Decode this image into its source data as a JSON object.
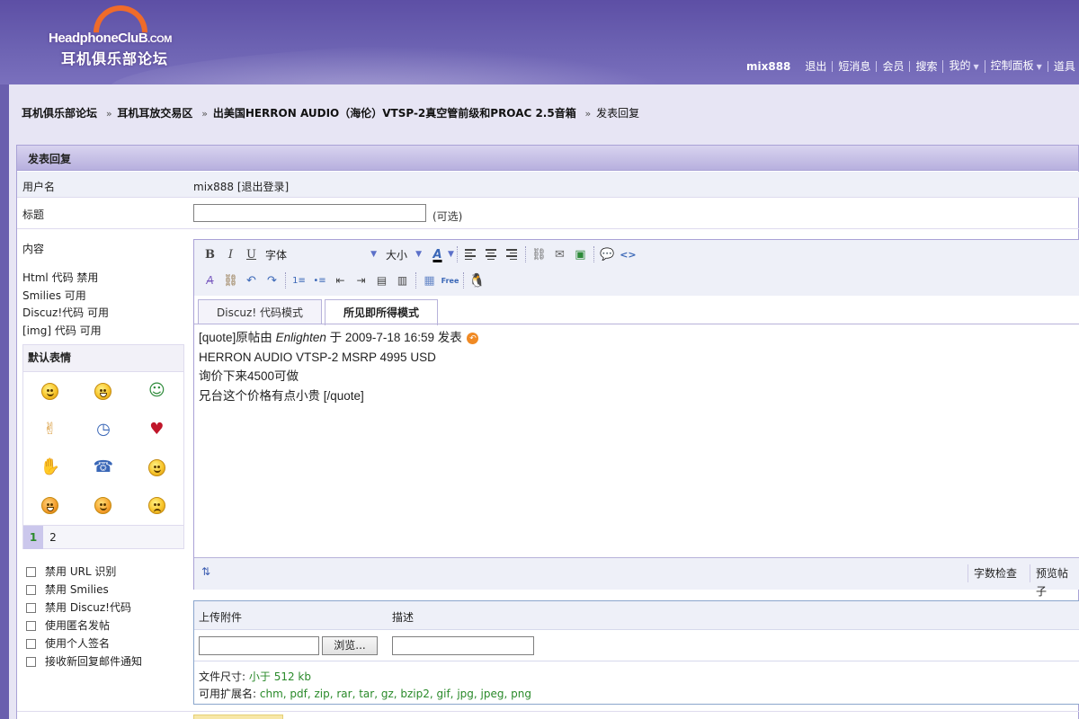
{
  "logo": {
    "text_en": "HeadphoneCluB",
    "text_com": ".COM",
    "text_cn": "耳机俱乐部论坛"
  },
  "topnav": {
    "username": "mix888",
    "links": [
      "退出",
      "短消息",
      "会员",
      "搜索",
      "我的",
      "控制面板",
      "道具"
    ]
  },
  "breadcrumb": {
    "items": [
      "耳机俱乐部论坛",
      "耳机耳放交易区",
      "出美国HERRON AUDIO（海伦）VTSP-2真空管前级和PROAC 2.5音箱",
      "发表回复"
    ],
    "separator": "»"
  },
  "panel": {
    "title": "发表回复"
  },
  "form": {
    "username_label": "用户名",
    "username_value": "mix888 [退出登录]",
    "subject_label": "标题",
    "subject_value": "",
    "optional_text": "(可选)",
    "content_label": "内容"
  },
  "code_status": [
    "Html 代码 禁用",
    "Smilies 可用",
    "Discuz!代码 可用",
    "[img] 代码 可用"
  ],
  "smilies": {
    "title": "默认表情",
    "pages": [
      "1",
      "2"
    ],
    "active_page": "1"
  },
  "options": [
    "禁用 URL 识别",
    "禁用 Smilies",
    "禁用 Discuz!代码",
    "使用匿名发帖",
    "使用个人签名",
    "接收新回复邮件通知"
  ],
  "editor": {
    "font_label": "字体",
    "size_label": "大小",
    "tabs": [
      "Discuz! 代码模式",
      "所见即所得模式"
    ],
    "active_tab": "所见即所得模式",
    "content": {
      "line1_prefix": "[quote]原帖由",
      "line1_author": "Enlighten",
      "line1_mid": "于  2009-7-18 16:59 发表",
      "line2": "HERRON AUDIO VTSP-2 MSRP 4995 USD",
      "line3": "询价下来4500可做",
      "line4": "兄台这个价格有点小贵  [/quote]"
    },
    "footer_buttons": [
      "字数检查",
      "预览帖子"
    ]
  },
  "attachment": {
    "upload_label": "上传附件",
    "desc_label": "描述",
    "browse_label": "浏览...",
    "size_label": "文件尺寸:",
    "size_value": "小于  512 kb",
    "ext_label": "可用扩展名:",
    "ext_value": "chm, pdf, zip, rar, tar, gz, bzip2, gif, jpg, jpeg, png"
  },
  "colors": {
    "header_purple": "#6a5fae",
    "panel_bg": "#e7e5f4",
    "accent_orange": "#f06b2a",
    "ok_green": "#2a8a2a"
  }
}
